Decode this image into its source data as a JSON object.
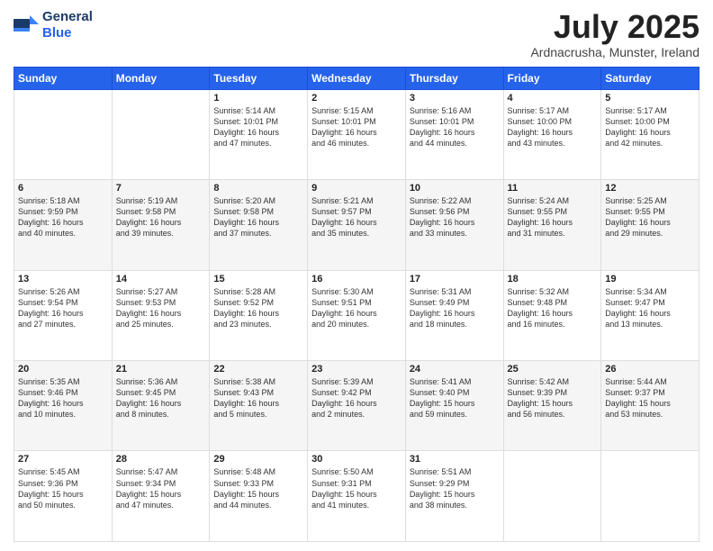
{
  "logo": {
    "general": "General",
    "blue": "Blue"
  },
  "header": {
    "month_year": "July 2025",
    "location": "Ardnacrusha, Munster, Ireland"
  },
  "weekdays": [
    "Sunday",
    "Monday",
    "Tuesday",
    "Wednesday",
    "Thursday",
    "Friday",
    "Saturday"
  ],
  "weeks": [
    [
      {
        "day": "",
        "info": ""
      },
      {
        "day": "",
        "info": ""
      },
      {
        "day": "1",
        "info": "Sunrise: 5:14 AM\nSunset: 10:01 PM\nDaylight: 16 hours\nand 47 minutes."
      },
      {
        "day": "2",
        "info": "Sunrise: 5:15 AM\nSunset: 10:01 PM\nDaylight: 16 hours\nand 46 minutes."
      },
      {
        "day": "3",
        "info": "Sunrise: 5:16 AM\nSunset: 10:01 PM\nDaylight: 16 hours\nand 44 minutes."
      },
      {
        "day": "4",
        "info": "Sunrise: 5:17 AM\nSunset: 10:00 PM\nDaylight: 16 hours\nand 43 minutes."
      },
      {
        "day": "5",
        "info": "Sunrise: 5:17 AM\nSunset: 10:00 PM\nDaylight: 16 hours\nand 42 minutes."
      }
    ],
    [
      {
        "day": "6",
        "info": "Sunrise: 5:18 AM\nSunset: 9:59 PM\nDaylight: 16 hours\nand 40 minutes."
      },
      {
        "day": "7",
        "info": "Sunrise: 5:19 AM\nSunset: 9:58 PM\nDaylight: 16 hours\nand 39 minutes."
      },
      {
        "day": "8",
        "info": "Sunrise: 5:20 AM\nSunset: 9:58 PM\nDaylight: 16 hours\nand 37 minutes."
      },
      {
        "day": "9",
        "info": "Sunrise: 5:21 AM\nSunset: 9:57 PM\nDaylight: 16 hours\nand 35 minutes."
      },
      {
        "day": "10",
        "info": "Sunrise: 5:22 AM\nSunset: 9:56 PM\nDaylight: 16 hours\nand 33 minutes."
      },
      {
        "day": "11",
        "info": "Sunrise: 5:24 AM\nSunset: 9:55 PM\nDaylight: 16 hours\nand 31 minutes."
      },
      {
        "day": "12",
        "info": "Sunrise: 5:25 AM\nSunset: 9:55 PM\nDaylight: 16 hours\nand 29 minutes."
      }
    ],
    [
      {
        "day": "13",
        "info": "Sunrise: 5:26 AM\nSunset: 9:54 PM\nDaylight: 16 hours\nand 27 minutes."
      },
      {
        "day": "14",
        "info": "Sunrise: 5:27 AM\nSunset: 9:53 PM\nDaylight: 16 hours\nand 25 minutes."
      },
      {
        "day": "15",
        "info": "Sunrise: 5:28 AM\nSunset: 9:52 PM\nDaylight: 16 hours\nand 23 minutes."
      },
      {
        "day": "16",
        "info": "Sunrise: 5:30 AM\nSunset: 9:51 PM\nDaylight: 16 hours\nand 20 minutes."
      },
      {
        "day": "17",
        "info": "Sunrise: 5:31 AM\nSunset: 9:49 PM\nDaylight: 16 hours\nand 18 minutes."
      },
      {
        "day": "18",
        "info": "Sunrise: 5:32 AM\nSunset: 9:48 PM\nDaylight: 16 hours\nand 16 minutes."
      },
      {
        "day": "19",
        "info": "Sunrise: 5:34 AM\nSunset: 9:47 PM\nDaylight: 16 hours\nand 13 minutes."
      }
    ],
    [
      {
        "day": "20",
        "info": "Sunrise: 5:35 AM\nSunset: 9:46 PM\nDaylight: 16 hours\nand 10 minutes."
      },
      {
        "day": "21",
        "info": "Sunrise: 5:36 AM\nSunset: 9:45 PM\nDaylight: 16 hours\nand 8 minutes."
      },
      {
        "day": "22",
        "info": "Sunrise: 5:38 AM\nSunset: 9:43 PM\nDaylight: 16 hours\nand 5 minutes."
      },
      {
        "day": "23",
        "info": "Sunrise: 5:39 AM\nSunset: 9:42 PM\nDaylight: 16 hours\nand 2 minutes."
      },
      {
        "day": "24",
        "info": "Sunrise: 5:41 AM\nSunset: 9:40 PM\nDaylight: 15 hours\nand 59 minutes."
      },
      {
        "day": "25",
        "info": "Sunrise: 5:42 AM\nSunset: 9:39 PM\nDaylight: 15 hours\nand 56 minutes."
      },
      {
        "day": "26",
        "info": "Sunrise: 5:44 AM\nSunset: 9:37 PM\nDaylight: 15 hours\nand 53 minutes."
      }
    ],
    [
      {
        "day": "27",
        "info": "Sunrise: 5:45 AM\nSunset: 9:36 PM\nDaylight: 15 hours\nand 50 minutes."
      },
      {
        "day": "28",
        "info": "Sunrise: 5:47 AM\nSunset: 9:34 PM\nDaylight: 15 hours\nand 47 minutes."
      },
      {
        "day": "29",
        "info": "Sunrise: 5:48 AM\nSunset: 9:33 PM\nDaylight: 15 hours\nand 44 minutes."
      },
      {
        "day": "30",
        "info": "Sunrise: 5:50 AM\nSunset: 9:31 PM\nDaylight: 15 hours\nand 41 minutes."
      },
      {
        "day": "31",
        "info": "Sunrise: 5:51 AM\nSunset: 9:29 PM\nDaylight: 15 hours\nand 38 minutes."
      },
      {
        "day": "",
        "info": ""
      },
      {
        "day": "",
        "info": ""
      }
    ]
  ]
}
